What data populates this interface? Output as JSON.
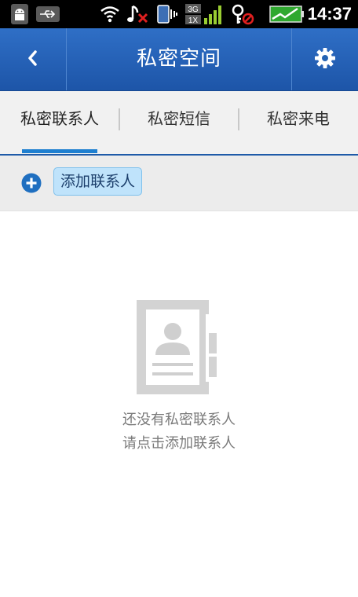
{
  "status_bar": {
    "time": "14:37",
    "network_label_top": "3G",
    "network_label_bottom": "1X",
    "icons": [
      "android-icon",
      "usb-icon",
      "wifi-icon",
      "music-muted-icon",
      "vibrate-icon",
      "signal-icon",
      "key-blocked-icon",
      "battery-icon"
    ]
  },
  "header": {
    "title": "私密空间",
    "back_icon": "chevron-left-icon",
    "settings_icon": "gear-icon"
  },
  "tabs": [
    {
      "label": "私密联系人",
      "selected": true
    },
    {
      "label": "私密短信",
      "selected": false
    },
    {
      "label": "私密来电",
      "selected": false
    }
  ],
  "actions": {
    "add_contact_label": "添加联系人"
  },
  "empty_state": {
    "line1": "还没有私密联系人",
    "line2": "请点击添加联系人"
  },
  "colors": {
    "header_blue": "#1d55a8",
    "accent": "#1e7fd0",
    "button_fill": "#bfe3fb"
  }
}
